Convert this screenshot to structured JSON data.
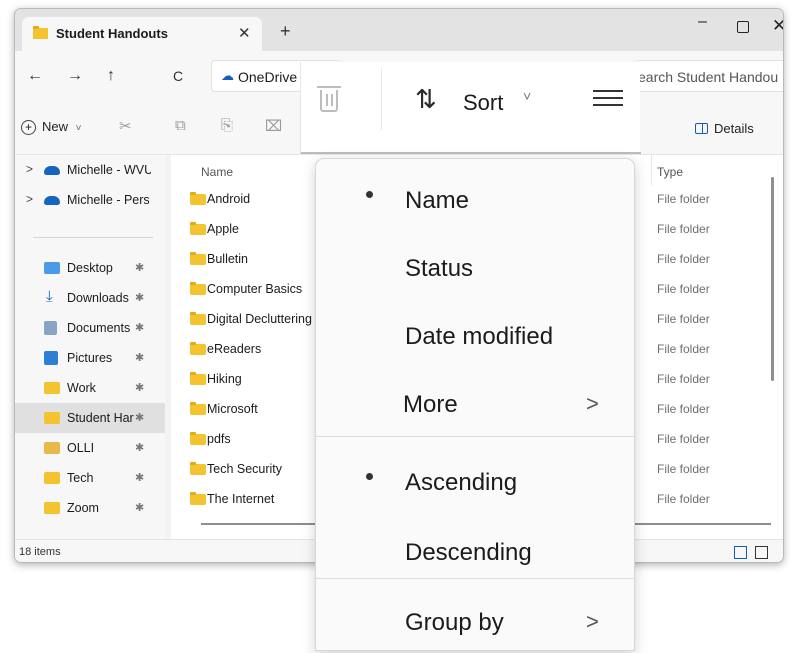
{
  "window": {
    "tab_title": "Student Handouts",
    "tab_close": "✕",
    "new_tab": "+",
    "min": "–",
    "close": "✕"
  },
  "nav": {
    "back": "←",
    "forward": "→",
    "up": "↑",
    "refresh": "C"
  },
  "address": {
    "location": "OneDrive"
  },
  "search": {
    "placeholder": "earch Student Handou"
  },
  "toolbar": {
    "new_label": "New",
    "new_chevron": "˅",
    "details_label": "Details"
  },
  "sidebar": {
    "items": [
      {
        "label": "Michelle - WVU",
        "chevron": ">",
        "pinned": false
      },
      {
        "label": "Michelle - Pers",
        "chevron": ">",
        "pinned": false
      },
      {
        "label": "Desktop",
        "pinned": true
      },
      {
        "label": "Downloads",
        "pinned": true
      },
      {
        "label": "Documents",
        "pinned": true
      },
      {
        "label": "Pictures",
        "pinned": true
      },
      {
        "label": "Work",
        "pinned": true
      },
      {
        "label": "Student Har",
        "pinned": true,
        "selected": true
      },
      {
        "label": "OLLI",
        "pinned": true
      },
      {
        "label": "Tech",
        "pinned": true
      },
      {
        "label": "Zoom",
        "pinned": true
      }
    ],
    "pin_glyph": "📌"
  },
  "files": {
    "col_name": "Name",
    "col_type": "Type",
    "rows": [
      {
        "name": "Android",
        "type": "File folder"
      },
      {
        "name": "Apple",
        "type": "File folder"
      },
      {
        "name": "Bulletin",
        "type": "File folder"
      },
      {
        "name": "Computer Basics",
        "type": "File folder"
      },
      {
        "name": "Digital Decluttering",
        "type": "File folder"
      },
      {
        "name": "eReaders",
        "type": "File folder"
      },
      {
        "name": "Hiking",
        "type": "File folder"
      },
      {
        "name": "Microsoft",
        "type": "File folder"
      },
      {
        "name": "pdfs",
        "type": "File folder"
      },
      {
        "name": "Tech Security",
        "type": "File folder"
      },
      {
        "name": "The Internet",
        "type": "File folder"
      }
    ]
  },
  "status": {
    "item_count": "18 items"
  },
  "sort_toolbar": {
    "sort_arrows": "⇅",
    "sort_label": "Sort",
    "sort_chevron": "˅"
  },
  "sort_menu": {
    "items": [
      {
        "label": "Name",
        "selected": true
      },
      {
        "label": "Status"
      },
      {
        "label": "Date modified"
      },
      {
        "label": "More",
        "submenu": true
      },
      {
        "label": "Ascending",
        "selected": true
      },
      {
        "label": "Descending"
      },
      {
        "label": "Group by",
        "submenu": true
      }
    ],
    "chevron": ">"
  }
}
